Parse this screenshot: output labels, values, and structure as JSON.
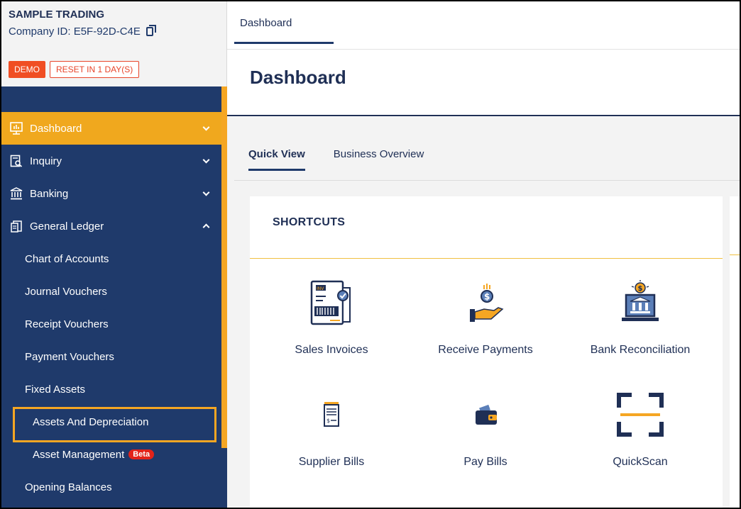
{
  "company": {
    "name": "SAMPLE TRADING",
    "id_text": "Company ID: E5F-92D-C4E",
    "demo_badge": "DEMO",
    "reset_badge": "RESET IN 1 DAY(S)"
  },
  "sidebar": {
    "items": [
      {
        "label": "Dashboard",
        "icon": "dashboard-icon"
      },
      {
        "label": "Inquiry",
        "icon": "inquiry-icon"
      },
      {
        "label": "Banking",
        "icon": "bank-icon"
      },
      {
        "label": "General Ledger",
        "icon": "ledger-icon"
      }
    ],
    "ledger_children": [
      "Chart of Accounts",
      "Journal Vouchers",
      "Receipt Vouchers",
      "Payment Vouchers",
      "Fixed Assets"
    ],
    "fixed_assets_children": [
      "Assets And Depreciation",
      "Asset Management"
    ],
    "beta_badge": "Beta",
    "after": "Opening Balances"
  },
  "topbar": {
    "tab": "Dashboard"
  },
  "header": {
    "title": "Dashboard"
  },
  "tabs": [
    "Quick View",
    "Business Overview"
  ],
  "card": {
    "title": "SHORTCUTS"
  },
  "shortcuts": [
    "Sales Invoices",
    "Receive Payments",
    "Bank Reconciliation",
    "Supplier Bills",
    "Pay Bills",
    "QuickScan"
  ],
  "colors": {
    "navy": "#1f3a6b",
    "accent": "#f0a81e",
    "demo": "#f04e23"
  }
}
